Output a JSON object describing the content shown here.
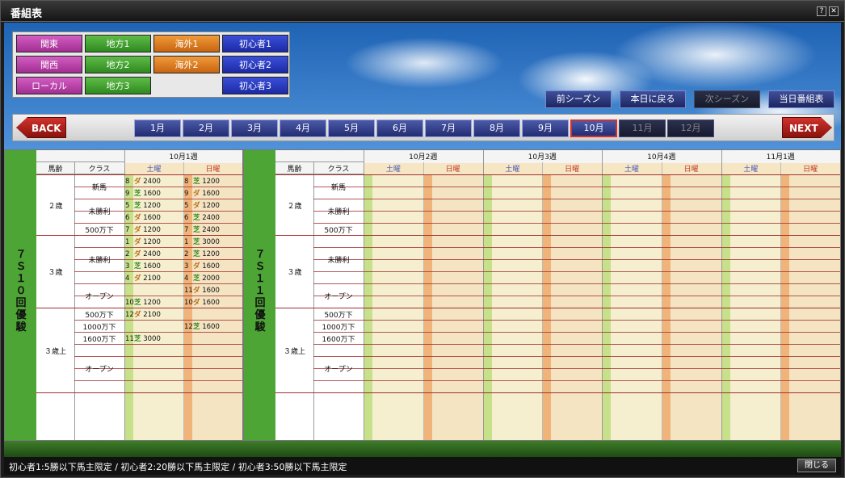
{
  "window": {
    "title": "番組表",
    "help_label": "?",
    "close_label": "✕"
  },
  "categories": [
    {
      "label": "関東",
      "color": "pink"
    },
    {
      "label": "地方1",
      "color": "green"
    },
    {
      "label": "海外1",
      "color": "orange"
    },
    {
      "label": "初心者1",
      "color": "blue"
    },
    {
      "label": "関西",
      "color": "pink"
    },
    {
      "label": "地方2",
      "color": "green"
    },
    {
      "label": "海外2",
      "color": "orange"
    },
    {
      "label": "初心者2",
      "color": "blue"
    },
    {
      "label": "ローカル",
      "color": "pink"
    },
    {
      "label": "地方3",
      "color": "green"
    },
    {
      "label": "",
      "color": "none"
    },
    {
      "label": "初心者3",
      "color": "blue"
    }
  ],
  "season_buttons": {
    "prev": "前シーズン",
    "today": "本日に戻る",
    "next": "次シーズン",
    "today_program": "当日番組表"
  },
  "nav": {
    "back": "BACK",
    "next": "NEXT",
    "months": [
      "1月",
      "2月",
      "3月",
      "4月",
      "5月",
      "6月",
      "7月",
      "8月",
      "9月",
      "10月",
      "11月",
      "12月"
    ],
    "selected_month": "10月"
  },
  "left_panel": {
    "band": "７Ｓ １０回 優駿",
    "col_age": "馬齢",
    "col_class": "クラス",
    "week": "10月1週",
    "sat": "土曜",
    "sun": "日曜"
  },
  "right_panel": {
    "band": "７Ｓ １１回 優駿",
    "col_age": "馬齢",
    "col_class": "クラス",
    "weeks": [
      "10月2週",
      "10月3週",
      "10月4週",
      "11月1週"
    ],
    "sat": "土曜",
    "sun": "日曜"
  },
  "rows": {
    "age2": "２歳",
    "age3": "３歳",
    "age3up": "３歳上",
    "c_new": "新馬",
    "c_maiden": "未勝利",
    "c_500": "500万下",
    "c_open": "オープン",
    "c_1000": "1000万下",
    "c_1600": "1600万下"
  },
  "races": {
    "sat": [
      {
        "no": "8",
        "type": "ダ",
        "dist": "2400"
      },
      {
        "no": "9",
        "type": "芝",
        "dist": "1600"
      },
      {
        "no": "5",
        "type": "芝",
        "dist": "1200"
      },
      {
        "no": "6",
        "type": "ダ",
        "dist": "1600"
      },
      {
        "no": "7",
        "type": "ダ",
        "dist": "1200"
      },
      {
        "no": "1",
        "type": "ダ",
        "dist": "1200"
      },
      {
        "no": "2",
        "type": "ダ",
        "dist": "2400"
      },
      {
        "no": "3",
        "type": "芝",
        "dist": "1600"
      },
      {
        "no": "4",
        "type": "ダ",
        "dist": "2100"
      },
      {
        "no": "",
        "type": "",
        "dist": ""
      },
      {
        "no": "10",
        "type": "芝",
        "dist": "1200"
      },
      {
        "no": "12",
        "type": "ダ",
        "dist": "2100"
      },
      {
        "no": "",
        "type": "",
        "dist": ""
      },
      {
        "no": "11",
        "type": "芝",
        "dist": "3000"
      }
    ],
    "sun": [
      {
        "no": "8",
        "type": "芝",
        "dist": "1200"
      },
      {
        "no": "9",
        "type": "ダ",
        "dist": "1600"
      },
      {
        "no": "5",
        "type": "ダ",
        "dist": "1200"
      },
      {
        "no": "6",
        "type": "芝",
        "dist": "2400"
      },
      {
        "no": "7",
        "type": "芝",
        "dist": "2400"
      },
      {
        "no": "1",
        "type": "芝",
        "dist": "3000"
      },
      {
        "no": "2",
        "type": "芝",
        "dist": "1200"
      },
      {
        "no": "3",
        "type": "ダ",
        "dist": "1600"
      },
      {
        "no": "4",
        "type": "芝",
        "dist": "2000"
      },
      {
        "no": "11",
        "type": "ダ",
        "dist": "1600"
      },
      {
        "no": "10",
        "type": "ダ",
        "dist": "1600"
      },
      {
        "no": "",
        "type": "",
        "dist": ""
      },
      {
        "no": "12",
        "type": "芝",
        "dist": "1600"
      },
      {
        "no": "",
        "type": "",
        "dist": ""
      }
    ]
  },
  "status": {
    "text": "初心者1:5勝以下馬主限定 / 初心者2:20勝以下馬主限定 / 初心者3:50勝以下馬主限定",
    "close": "閉じる"
  }
}
